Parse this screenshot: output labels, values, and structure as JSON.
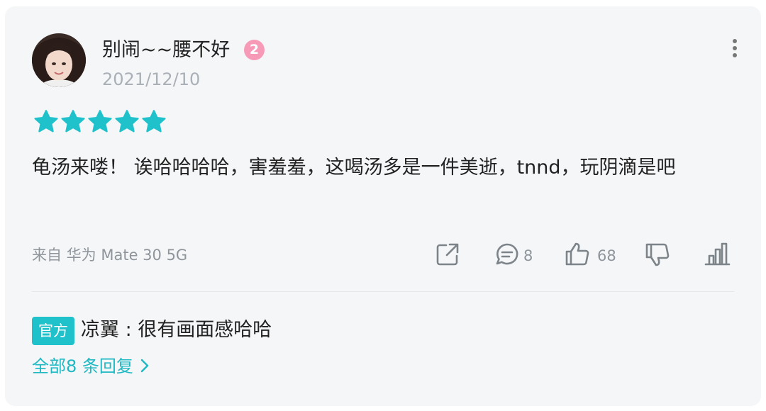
{
  "user": {
    "name": "别闹~~腰不好",
    "level": "2",
    "date": "2021/12/10"
  },
  "rating": {
    "stars": 5,
    "max": 5,
    "color": "#1fc1cb"
  },
  "content": "龟汤来喽！ 诶哈哈哈哈，害羞羞，这喝汤多是一件美逝，tnnd，玩阴滴是吧",
  "device": "来自 华为 Mate 30 5G",
  "actions": {
    "comment_count": "8",
    "like_count": "68"
  },
  "reply": {
    "badge": "官方",
    "text": "凉翼 : 很有画面感哈哈",
    "all_replies": "全部8 条回复"
  },
  "icons": [
    "more-icon",
    "share-icon",
    "comment-icon",
    "like-icon",
    "dislike-icon",
    "stats-icon",
    "chevron-right-icon"
  ]
}
